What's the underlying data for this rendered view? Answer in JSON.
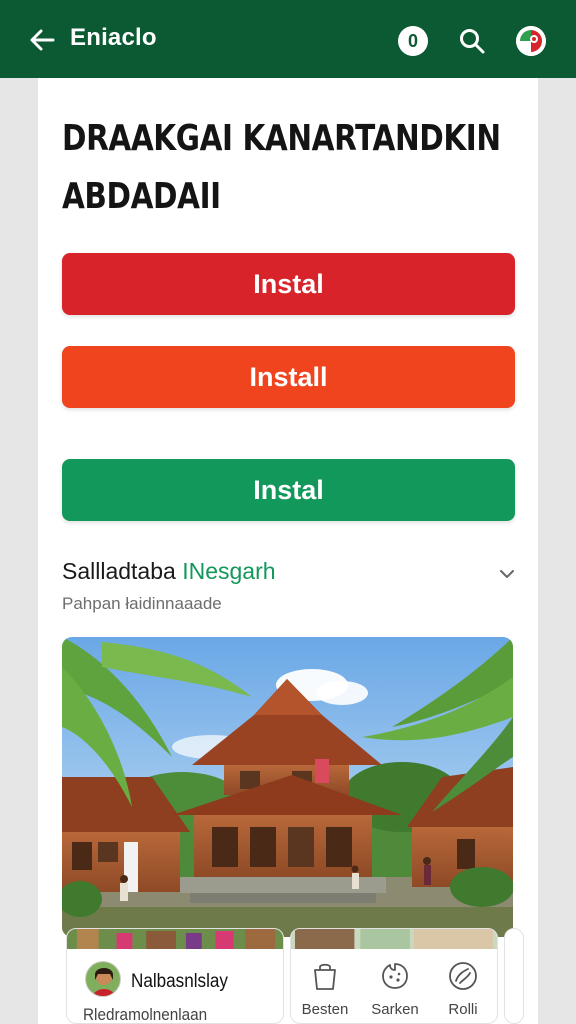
{
  "topbar": {
    "title": "Eniaclo",
    "badge_count": "0",
    "background": "#0b5a33"
  },
  "headline": {
    "line1": "DRAAKGAI KANARTANDKIN",
    "line2": "ABDADAII"
  },
  "buttons": [
    {
      "label": "Instal",
      "color": "#d8232a"
    },
    {
      "label": "Install",
      "color": "#f0441f"
    },
    {
      "label": "Instal",
      "color": "#12985a"
    }
  ],
  "section": {
    "title_plain": "Sallladtaba ",
    "title_accent": "INesgarh",
    "subtitle": "Pahpan  łaidinnaaade",
    "accent_color": "#12985a"
  },
  "profile": {
    "name": "Nalbasnlslay",
    "subtitle": "Rledramolnenlaan"
  },
  "actions": [
    {
      "label": "Besten",
      "icon": "bag-icon"
    },
    {
      "label": "Sarken",
      "icon": "cookie-icon"
    },
    {
      "label": "Rolli",
      "icon": "swirl-icon"
    }
  ]
}
